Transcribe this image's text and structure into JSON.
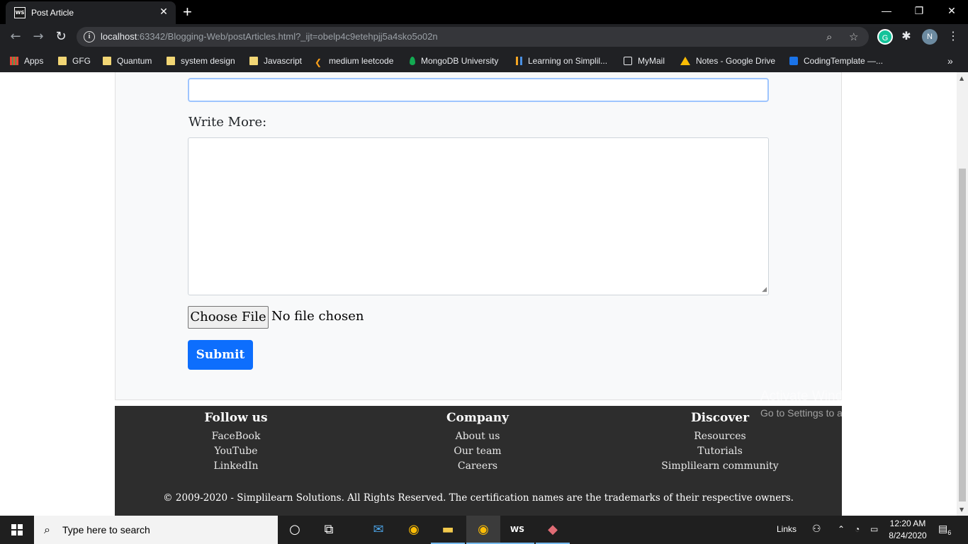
{
  "browser": {
    "tab_title": "Post Article",
    "tab_favicon": "WS",
    "new_tab": "+",
    "url_host": "localhost",
    "url_rest": ":63342/Blogging-Web/postArticles.html?_ijt=obelp4c9etehpjj5a4sko5o02n",
    "profile_initial": "N",
    "extension_initial": "G"
  },
  "bookmarks": [
    {
      "label": "Apps",
      "icon": "apps-grid-icon"
    },
    {
      "label": "GFG",
      "icon": "folder-icon"
    },
    {
      "label": "Quantum",
      "icon": "folder-icon"
    },
    {
      "label": "system design",
      "icon": "folder-icon"
    },
    {
      "label": "Javascript",
      "icon": "folder-icon"
    },
    {
      "label": "medium leetcode",
      "icon": "leetcode-icon"
    },
    {
      "label": "MongoDB University",
      "icon": "mongodb-leaf-icon"
    },
    {
      "label": "Learning on Simplil...",
      "icon": "simplilearn-icon"
    },
    {
      "label": "MyMail",
      "icon": "mail-icon"
    },
    {
      "label": "Notes - Google Drive",
      "icon": "google-drive-icon"
    },
    {
      "label": "CodingTemplate —...",
      "icon": "bookmark-icon"
    }
  ],
  "form": {
    "write_more_label": "Write More:",
    "choose_file_label": "Choose File",
    "file_status": "No file chosen",
    "submit_label": "Submit"
  },
  "footer": {
    "columns": [
      {
        "heading": "Follow us",
        "links": [
          "FaceBook",
          "YouTube",
          "LinkedIn"
        ]
      },
      {
        "heading": "Company",
        "links": [
          "About us",
          "Our team",
          "Careers"
        ]
      },
      {
        "heading": "Discover",
        "links": [
          "Resources",
          "Tutorials",
          "Simplilearn community"
        ]
      }
    ],
    "copyright": "© 2009-2020 - Simplilearn Solutions. All Rights Reserved. The certification names are the trademarks of their respective owners."
  },
  "watermark": {
    "line1": "Activate Windows",
    "line2": "Go to Settings to activate Windows."
  },
  "taskbar": {
    "search_placeholder": "Type here to search",
    "links_label": "Links",
    "time": "12:20 AM",
    "date": "8/24/2020",
    "notification_count": "6"
  },
  "colors": {
    "accent": "#0d6efd",
    "footer_bg": "#2d2d2d",
    "chrome_bg": "#202124"
  }
}
